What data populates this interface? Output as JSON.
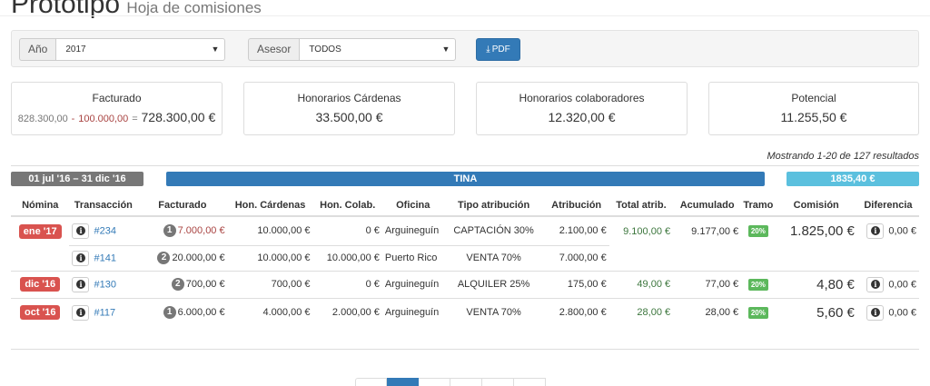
{
  "header": {
    "title": "Prototipo",
    "subtitle": "Hoja de comisiones"
  },
  "filters": {
    "year_label": "Año",
    "year_value": "2017",
    "advisor_label": "Asesor",
    "advisor_value": "TODOS",
    "pdf_label": "PDF"
  },
  "stats": {
    "facturado": {
      "label": "Facturado",
      "gross": "828.300,00",
      "minus": "-",
      "deduction": "100.000,00",
      "equals": "=",
      "value": "728.300,00 €"
    },
    "honorarios_cardenas": {
      "label": "Honorarios Cárdenas",
      "value": "33.500,00 €"
    },
    "honorarios_colaboradores": {
      "label": "Honorarios colaboradores",
      "value": "12.320,00 €"
    },
    "potencial": {
      "label": "Potencial",
      "value": "11.255,50 €"
    }
  },
  "results_info": "Mostrando 1-20 de 127 resultados",
  "period": {
    "range": "01 jul '16 – 31 dic '16",
    "advisor": "TINA",
    "total": "1835,40 €",
    "colors": {
      "range": "#777777",
      "advisor": "#337ab7",
      "total": "#5bc0de"
    }
  },
  "table": {
    "headers": {
      "nomina": "Nómina",
      "transaccion": "Transacción",
      "facturado": "Facturado",
      "hon_cardenas": "Hon. Cárdenas",
      "hon_colab": "Hon. Colab.",
      "oficina": "Oficina",
      "tipo": "Tipo atribución",
      "atribucion": "Atribución",
      "total": "Total atrib.",
      "acumulado": "Acumulado",
      "tramo": "Tramo",
      "comision": "Comisión",
      "diferencia": "Diferencia"
    },
    "rows": [
      {
        "nomina": "ene '17",
        "transaccion": "#234",
        "badge": "1",
        "facturado": "7.000,00 €",
        "hon_cardenas": "10.000,00 €",
        "hon_colab": "0 €",
        "oficina": "Arguineguín",
        "tipo": "CAPTACIÓN 30%",
        "atribucion": "2.100,00 €",
        "total": "9.100,00 €",
        "acumulado": "9.177,00 €",
        "tramo": "20%",
        "comision": "1.825,00 €",
        "diferencia": "0,00 €"
      },
      {
        "nomina": "",
        "transaccion": "#141",
        "badge": "2",
        "facturado": "20.000,00 €",
        "hon_cardenas": "10.000,00 €",
        "hon_colab": "10.000,00 €",
        "oficina": "Puerto Rico",
        "tipo": "VENTA 70%",
        "atribucion": "7.000,00 €",
        "total": "",
        "acumulado": "",
        "tramo": "",
        "comision": "",
        "diferencia": ""
      },
      {
        "nomina": "dic '16",
        "transaccion": "#130",
        "badge": "2",
        "facturado": "700,00 €",
        "hon_cardenas": "700,00 €",
        "hon_colab": "0 €",
        "oficina": "Arguineguín",
        "tipo": "ALQUILER 25%",
        "atribucion": "175,00 €",
        "total": "49,00 €",
        "acumulado": "77,00 €",
        "tramo": "20%",
        "comision": "4,80 €",
        "diferencia": "0,00 €"
      },
      {
        "nomina": "oct '16",
        "transaccion": "#117",
        "badge": "1",
        "facturado": "6.000,00 €",
        "hon_cardenas": "4.000,00 €",
        "hon_colab": "2.000,00 €",
        "oficina": "Arguineguín",
        "tipo": "VENTA 70%",
        "atribucion": "2.800,00 €",
        "total": "28,00 €",
        "acumulado": "28,00 €",
        "tramo": "20%",
        "comision": "5,60 €",
        "diferencia": "0,00 €"
      }
    ]
  },
  "pagination": {
    "pages": 6,
    "active_page_index": 1
  }
}
